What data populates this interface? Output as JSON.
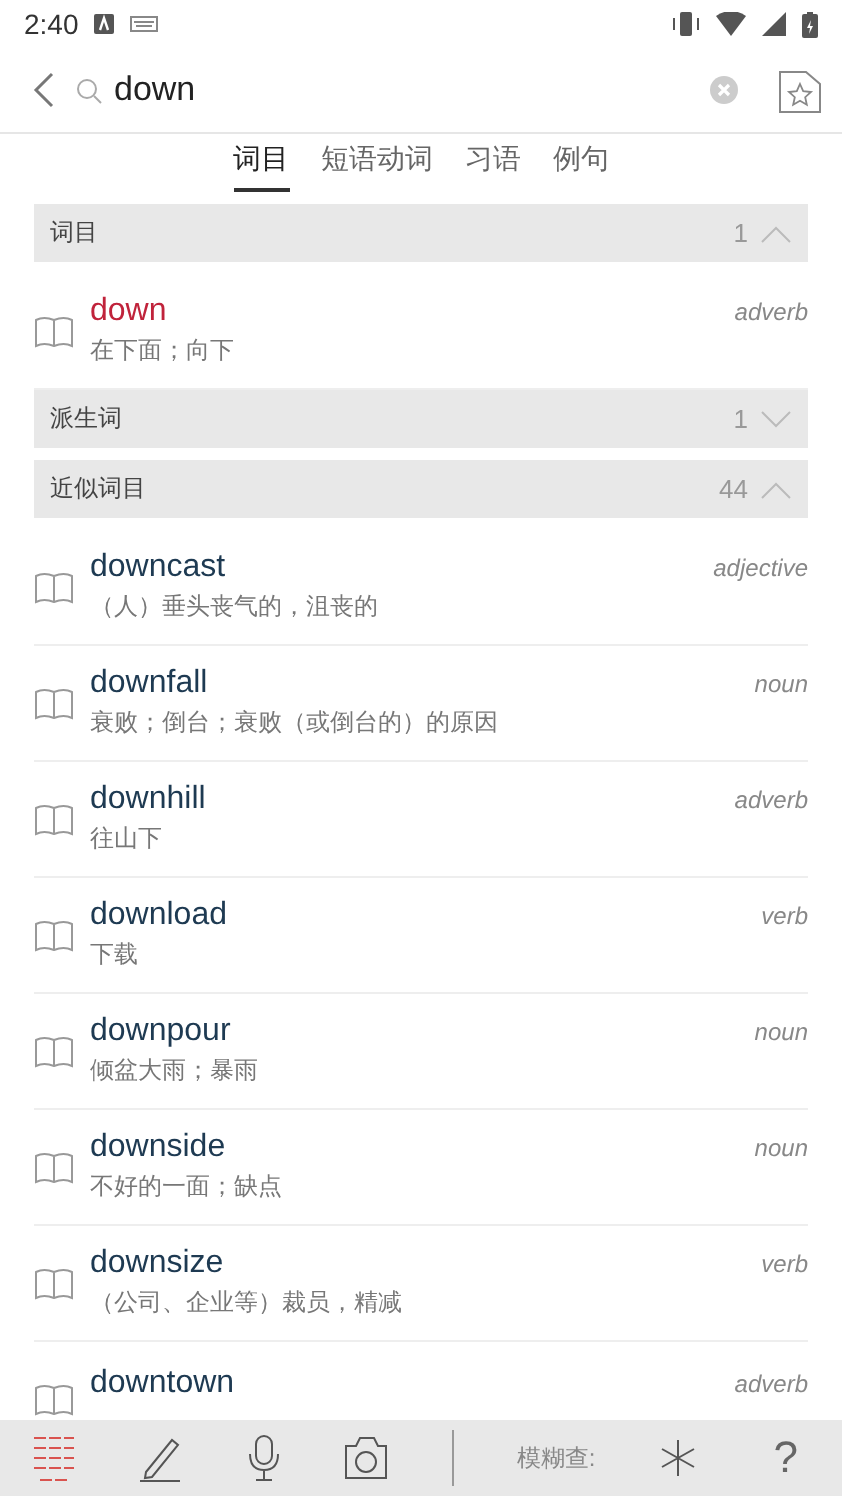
{
  "status_bar": {
    "time": "2:40"
  },
  "search": {
    "value": "down"
  },
  "tabs": [
    {
      "label": "词目",
      "selected": true
    },
    {
      "label": "短语动词",
      "selected": false
    },
    {
      "label": "习语",
      "selected": false
    },
    {
      "label": "例句",
      "selected": false
    }
  ],
  "sections": [
    {
      "title": "词目",
      "count": "1",
      "expanded": true,
      "entries": [
        {
          "word": "down",
          "pos": "adverb",
          "gloss": "在下面；向下",
          "match": true
        }
      ]
    },
    {
      "title": "派生词",
      "count": "1",
      "expanded": false
    },
    {
      "title": "近似词目",
      "count": "44",
      "expanded": true,
      "entries": [
        {
          "word": "downcast",
          "pos": "adjective",
          "gloss": "（人）垂头丧气的，沮丧的",
          "match": false
        },
        {
          "word": "downfall",
          "pos": "noun",
          "gloss": "衰败；倒台；衰败（或倒台的）的原因",
          "match": false
        },
        {
          "word": "downhill",
          "pos": "adverb",
          "gloss": "往山下",
          "match": false
        },
        {
          "word": "download",
          "pos": "verb",
          "gloss": "下载",
          "match": false
        },
        {
          "word": "downpour",
          "pos": "noun",
          "gloss": "倾盆大雨；暴雨",
          "match": false
        },
        {
          "word": "downside",
          "pos": "noun",
          "gloss": "不好的一面；缺点",
          "match": false
        },
        {
          "word": "downsize",
          "pos": "verb",
          "gloss": "（公司、企业等）裁员，精减",
          "match": false
        },
        {
          "word": "downtown",
          "pos": "adverb",
          "match": false
        }
      ]
    }
  ],
  "toolbar": {
    "tools": [
      {
        "kind": "list",
        "selected": true
      },
      {
        "kind": "pencil",
        "selected": false
      },
      {
        "kind": "mic",
        "selected": false
      },
      {
        "kind": "camera",
        "selected": false
      }
    ],
    "fuzzy_label": "模糊查:",
    "help": "?"
  }
}
